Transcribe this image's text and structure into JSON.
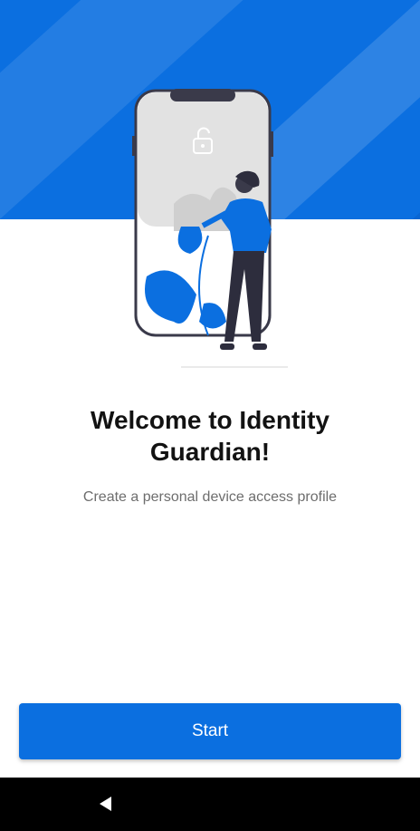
{
  "colors": {
    "brand": "#0b6fe0",
    "title": "#121212",
    "subtitle": "#6d6d6d",
    "nav_bar": "#000000"
  },
  "illustration": {
    "name": "woman-with-phone-illustration",
    "icon": "unlock-icon"
  },
  "welcome": {
    "title": "Welcome to Identity Guardian!",
    "subtitle": "Create a personal device access profile"
  },
  "actions": {
    "start_label": "Start"
  },
  "system_nav": {
    "back_icon": "back-triangle-icon"
  }
}
